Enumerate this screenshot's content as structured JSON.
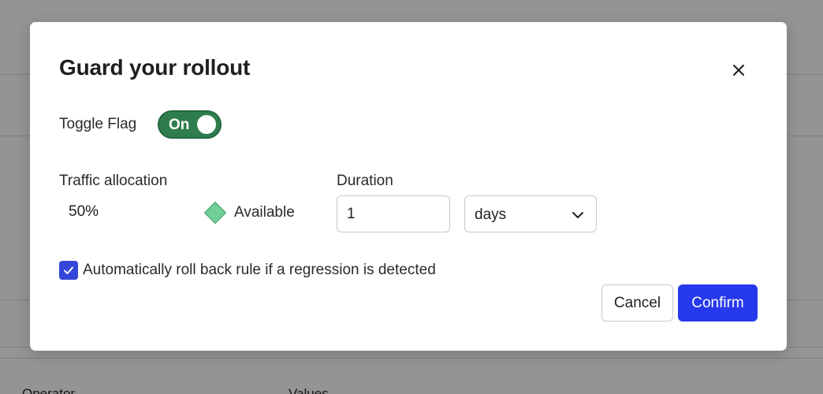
{
  "background": {
    "labels": [
      "Operator",
      "Values"
    ]
  },
  "modal": {
    "title": "Guard your rollout",
    "toggle": {
      "label": "Toggle Flag",
      "state_text": "On",
      "on": true
    },
    "traffic_allocation": {
      "label": "Traffic allocation",
      "value": "50%",
      "status_icon": "diamond-icon",
      "status_text": "Available",
      "status_color": "#6fcf97"
    },
    "duration": {
      "label": "Duration",
      "amount": "1",
      "unit": "days",
      "unit_options": [
        "days"
      ]
    },
    "rollback_checkbox": {
      "checked": true,
      "label": "Automatically roll back rule if a regression is detected"
    },
    "buttons": {
      "cancel": "Cancel",
      "confirm": "Confirm"
    }
  },
  "colors": {
    "toggle_on": "#2f7d4e",
    "primary": "#2639ec",
    "checkbox": "#3346d8"
  }
}
